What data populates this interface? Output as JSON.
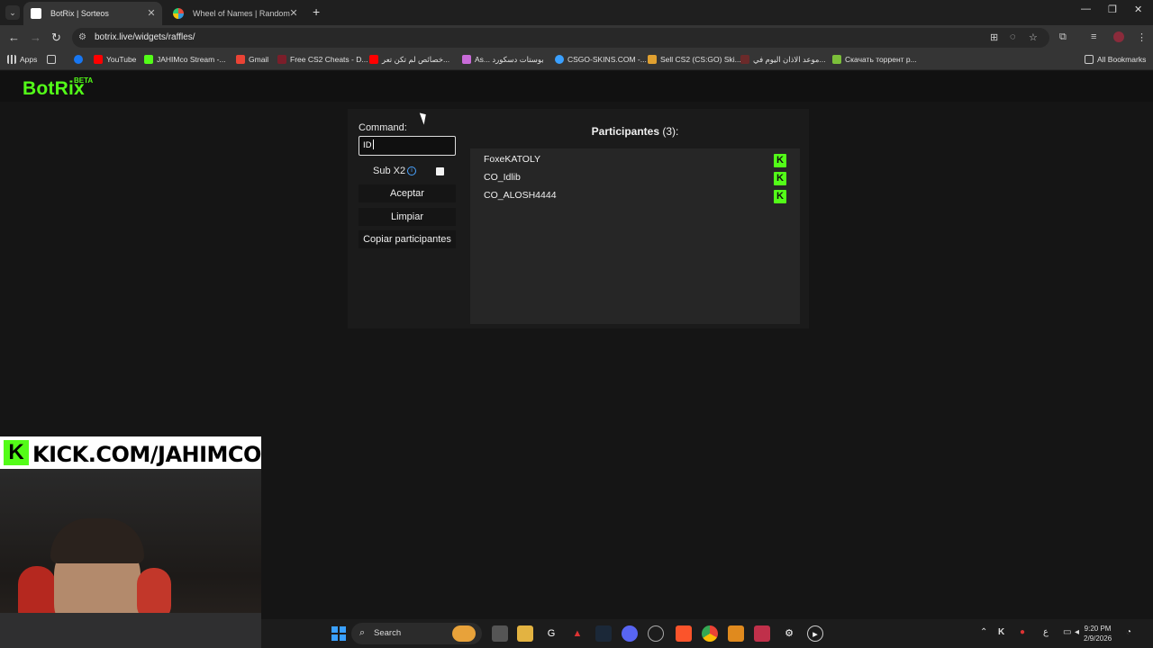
{
  "browser": {
    "tabs": [
      {
        "title": "BotRix | Sorteos",
        "active": true
      },
      {
        "title": "Wheel of Names | Random nam",
        "active": false
      }
    ],
    "url": "botrix.live/widgets/raffles/",
    "bookmarks": [
      {
        "label": "Apps",
        "icon": "apps-grid-icon"
      },
      {
        "label": "",
        "icon": "grid-icon"
      },
      {
        "label": "",
        "icon": "facebook-icon"
      },
      {
        "label": "YouTube",
        "icon": "youtube-icon"
      },
      {
        "label": "JAHIMco Stream -...",
        "icon": "kick-icon"
      },
      {
        "label": "Gmail",
        "icon": "gmail-icon"
      },
      {
        "label": "Free CS2 Cheats - D...",
        "icon": "cheat-icon"
      },
      {
        "label": "خصائص لم تكن تعر...",
        "icon": "youtube-icon"
      },
      {
        "label": "As... بوستات دسكورد",
        "icon": "gem-icon"
      },
      {
        "label": "CSGO-SKINS.COM -...",
        "icon": "skins-icon"
      },
      {
        "label": "Sell CS2 (CS:GO) Ski...",
        "icon": "sell-icon"
      },
      {
        "label": "موعد الاذان اليوم في...",
        "icon": "mosque-icon"
      },
      {
        "label": "Скачать торрент р...",
        "icon": "torrent-icon"
      }
    ],
    "all_bookmarks_label": "All Bookmarks"
  },
  "site": {
    "logo": "BotRix",
    "badge": "BETA"
  },
  "raffle": {
    "command_label": "Command:",
    "command_value": "ID",
    "sub_label": "Sub X2",
    "sub_checked": false,
    "accept_label": "Aceptar",
    "clear_label": "Limpiar",
    "copy_label": "Copiar participantes",
    "participants_title": "Participantes",
    "participants_count": "(3):",
    "participants": [
      {
        "name": "FoxeKATOLY",
        "platform_badge": "K"
      },
      {
        "name": "CO_Idlib",
        "platform_badge": "K"
      },
      {
        "name": "CO_ALOSH4444",
        "platform_badge": "K"
      }
    ]
  },
  "overlay": {
    "kick_badge": "K",
    "kick_text": "KICK.COM/JAHIMCO"
  },
  "taskbar": {
    "search_label": "Search",
    "time": "9:20 PM",
    "date": "2/9/2026",
    "lang": "ع"
  },
  "colors": {
    "kick_green": "#53fc18",
    "page_bg": "#151515",
    "panel_bg": "#1b1b1b"
  }
}
